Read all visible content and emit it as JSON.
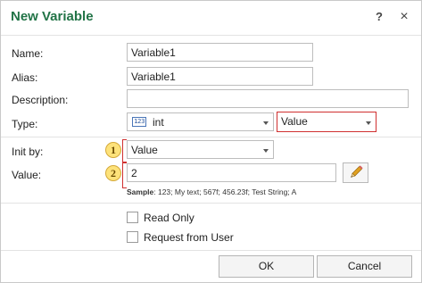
{
  "dialog": {
    "title": "New Variable",
    "help_glyph": "?",
    "close_glyph": "×"
  },
  "form": {
    "name": {
      "label": "Name:",
      "value": "Variable1"
    },
    "alias": {
      "label": "Alias:",
      "value": "Variable1"
    },
    "description": {
      "label": "Description:",
      "value": ""
    },
    "type": {
      "label": "Type:",
      "type_icon_text": "123",
      "type_value": "int",
      "kind_value": "Value"
    },
    "init_by": {
      "label": "Init by:",
      "value": "Value",
      "badge": "1"
    },
    "value": {
      "label": "Value:",
      "value": "2",
      "badge": "2"
    },
    "sample": {
      "prefix": "Sample",
      "text": ": 123; My text; 567f; 456.23f; Test String; A"
    }
  },
  "options": {
    "read_only": {
      "label": "Read Only",
      "checked": false
    },
    "request_from_user": {
      "label": "Request from User",
      "checked": false
    }
  },
  "buttons": {
    "ok": "OK",
    "cancel": "Cancel"
  },
  "colors": {
    "title": "#217346",
    "highlight_border": "#d03030",
    "badge_fill": "#fde27a"
  }
}
